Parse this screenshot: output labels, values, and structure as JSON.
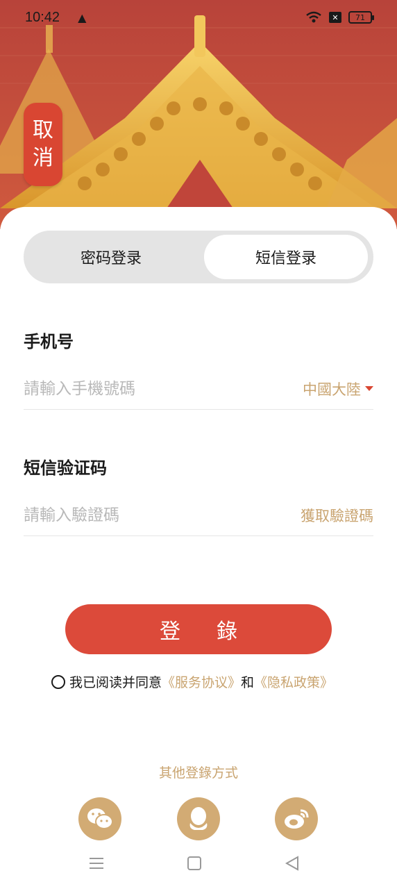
{
  "status_bar": {
    "time": "10:42",
    "battery": "71"
  },
  "header": {
    "cancel_label_line1": "取",
    "cancel_label_line2": "消"
  },
  "tabs": [
    {
      "label": "密码登录",
      "active": false
    },
    {
      "label": "短信登录",
      "active": true
    }
  ],
  "phone_field": {
    "label": "手机号",
    "placeholder": "請輸入手機號碼",
    "region": "中國大陸"
  },
  "code_field": {
    "label": "短信验证码",
    "placeholder": "請輸入驗證碼",
    "get_code": "獲取驗證碼"
  },
  "login_button": "登錄",
  "agreement": {
    "prefix": "我已阅读并同意",
    "terms": "《服务协议》",
    "and": "和",
    "privacy": "《隐私政策》"
  },
  "other_login": {
    "title": "其他登錄方式",
    "methods": [
      "wechat-icon",
      "qq-icon",
      "weibo-icon"
    ]
  },
  "colors": {
    "accent_red": "#dc4a3a",
    "gold": "#c9a470",
    "social_bg": "#d2ab74"
  }
}
